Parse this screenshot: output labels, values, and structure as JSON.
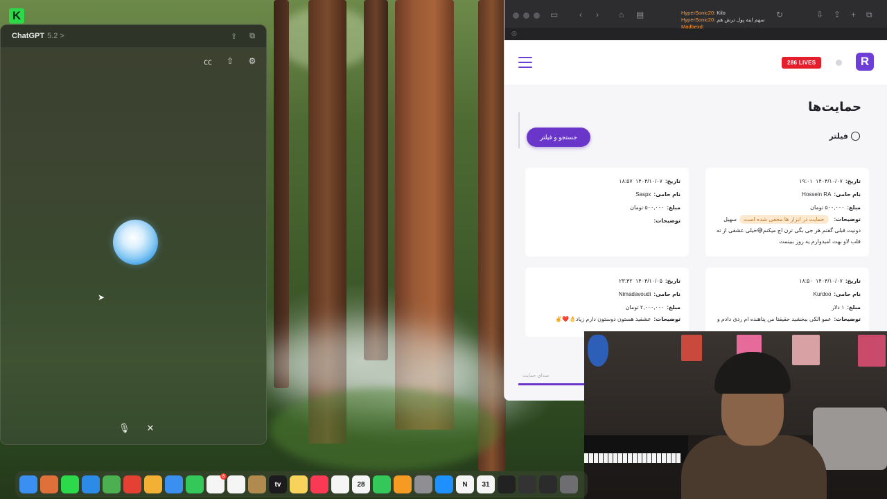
{
  "chatgpt": {
    "app_name": "ChatGPT",
    "version": "5.2",
    "chevron": ">"
  },
  "browser": {
    "site": {
      "live_badge": "286 LIVES",
      "logo_letter": "R",
      "page_title": "حمایت‌ها",
      "filter_label": "فیلتر",
      "search_button": "جستجو و فیلتر",
      "tab_label": "صدای حمایت"
    },
    "stream_chat": [
      {
        "user": "HyperSonic20",
        "text": "Kilo"
      },
      {
        "user": "HyperSonic20",
        "text": "سهم اینه پول ترش هم"
      },
      {
        "user": "Madbexd",
        "text": ""
      }
    ],
    "donations": [
      {
        "date_label": "تاریخ:",
        "date": "۱۴۰۴/۱۰/۰۷",
        "time": "۱۹:۰۱",
        "name_label": "نام حامی:",
        "name": "Hossein RA",
        "amount_label": "مبلغ:",
        "amount": "۵۰۰,۰۰۰ تومان",
        "desc_label": "توضیحات:",
        "tag": "حمایت در ابزار ها مخفی شده است",
        "desc": "سهیل دونیت قبلی گفتم هر جی بگی ترن اچ میکنم😅خیلی عشقی از ته قلب لاو بهت امیدوارم یه روز ببینمت"
      },
      {
        "date_label": "تاریخ:",
        "date": "۱۴۰۴/۱۰/۰۷",
        "time": "۱۸:۵۷",
        "name_label": "نام حامی:",
        "name": "Saspx",
        "amount_label": "مبلغ:",
        "amount": "۵۰۰,۰۰۰ تومان",
        "desc_label": "توضیحات:",
        "tag": "",
        "desc": ""
      },
      {
        "date_label": "تاریخ:",
        "date": "۱۴۰۴/۱۰/۰۷",
        "time": "۱۸:۵۰",
        "name_label": "نام حامی:",
        "name": "Kurdoo",
        "amount_label": "مبلغ:",
        "amount": "۱ دلار",
        "desc_label": "توضیحات:",
        "tag": "",
        "desc": "عمو الکی ببخشید حقیقتا من پناهنده ام ردی دادم و"
      },
      {
        "date_label": "تاریخ:",
        "date": "۱۴۰۴/۱۰/۰۵",
        "time": "۲۳:۴۲",
        "name_label": "نام حامی:",
        "name": "Nimadavoudi",
        "amount_label": "مبلغ:",
        "amount": "۲,۰۰۰,۰۰۰ تومان",
        "desc_label": "توضیحات:",
        "tag": "",
        "desc": "عشقید هستون دوستون دارم زیاد👌❤️✌️"
      }
    ]
  },
  "dock": {
    "apps": [
      {
        "name": "finder-icon",
        "label": "",
        "color": "#3a8ff0"
      },
      {
        "name": "launchpad-icon",
        "label": "",
        "color": "#e0703a"
      },
      {
        "name": "kick-icon",
        "label": "",
        "color": "#2bd94b"
      },
      {
        "name": "safari-icon",
        "label": "",
        "color": "#2d8be8"
      },
      {
        "name": "maps-icon",
        "label": "",
        "color": "#4caf50"
      },
      {
        "name": "chrome-icon",
        "label": "",
        "color": "#e44134"
      },
      {
        "name": "photos-icon",
        "label": "",
        "color": "#f2b134"
      },
      {
        "name": "mail-icon",
        "label": "",
        "color": "#3a8ff0"
      },
      {
        "name": "facetime-icon",
        "label": "",
        "color": "#34c759"
      },
      {
        "name": "reminders-icon",
        "label": "",
        "color": "#f5f5f5",
        "badge": "6"
      },
      {
        "name": "freeform-icon",
        "label": "",
        "color": "#f5f5f5"
      },
      {
        "name": "notes-brown-icon",
        "label": "",
        "color": "#b08a4f"
      },
      {
        "name": "appletv-icon",
        "label": "tv",
        "color": "#1c1c1e"
      },
      {
        "name": "notes-icon",
        "label": "",
        "color": "#f7d35b"
      },
      {
        "name": "music-icon",
        "label": "",
        "color": "#fa3a55"
      },
      {
        "name": "news-icon",
        "label": "",
        "color": "#f5f5f5"
      },
      {
        "name": "calendar-icon",
        "label": "28",
        "color": "#f5f5f5"
      },
      {
        "name": "numbers-icon",
        "label": "",
        "color": "#34c759"
      },
      {
        "name": "pages-icon",
        "label": "",
        "color": "#f59a23"
      },
      {
        "name": "settings-icon",
        "label": "",
        "color": "#8e8e93"
      },
      {
        "name": "appstore-icon",
        "label": "",
        "color": "#1e90ff"
      },
      {
        "name": "notion-icon",
        "label": "N",
        "color": "#f5f5f5"
      },
      {
        "name": "calendar31-icon",
        "label": "31",
        "color": "#f5f5f5"
      },
      {
        "name": "obs-icon",
        "label": "",
        "color": "#222"
      },
      {
        "name": "streamdeck-icon",
        "label": "",
        "color": "#333"
      },
      {
        "name": "unity-icon",
        "label": "",
        "color": "#2b2b2b"
      },
      {
        "name": "utility-icon",
        "label": "",
        "color": "#6d6d72"
      }
    ]
  }
}
